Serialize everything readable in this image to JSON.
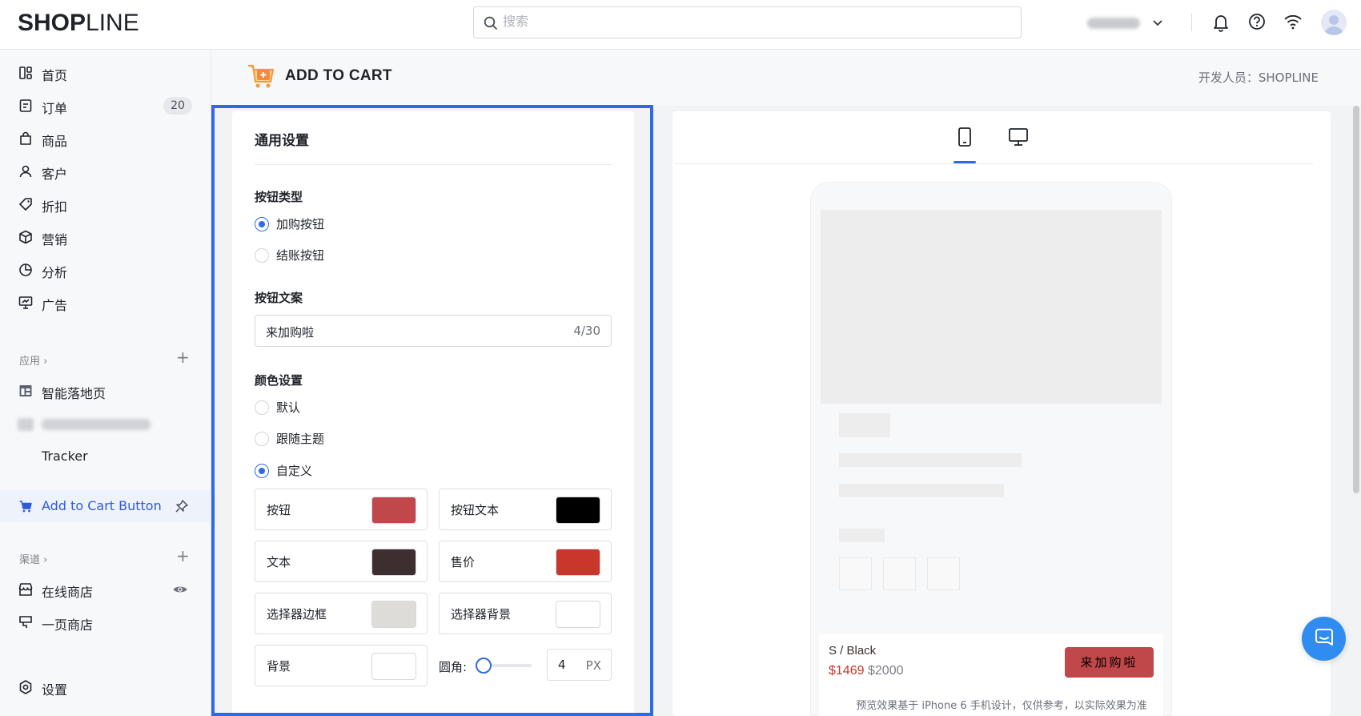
{
  "header": {
    "logo_bold": "SHOP",
    "logo_light": "LINE",
    "search_placeholder": "搜索",
    "icons": [
      "bell-icon",
      "help-icon",
      "wifi-icon",
      "avatar"
    ]
  },
  "sidebar": {
    "items": [
      {
        "label": "首页",
        "icon": "dashboard-icon"
      },
      {
        "label": "订单",
        "icon": "order-icon",
        "badge": "20"
      },
      {
        "label": "商品",
        "icon": "bag-icon"
      },
      {
        "label": "客户",
        "icon": "user-icon"
      },
      {
        "label": "折扣",
        "icon": "tag-icon"
      },
      {
        "label": "营销",
        "icon": "box-icon"
      },
      {
        "label": "分析",
        "icon": "pie-icon"
      },
      {
        "label": "广告",
        "icon": "ad-icon"
      }
    ],
    "apps_label": "应用",
    "apps": [
      {
        "label": "智能落地页",
        "icon": "layout-icon"
      },
      {
        "label": "Tracker",
        "icon": ""
      }
    ],
    "selected_app": "Add to Cart Button",
    "channels_label": "渠道",
    "channels": [
      {
        "label": "在线商店",
        "icon": "store-icon"
      },
      {
        "label": "一页商店",
        "icon": "page-store-icon"
      }
    ],
    "settings_label": "设置"
  },
  "page": {
    "title": "ADD TO CART",
    "developer": "开发人员：SHOPLINE"
  },
  "settings": {
    "title": "通用设置",
    "button_type_label": "按钮类型",
    "button_types": [
      "加购按钮",
      "结账按钮"
    ],
    "button_type_selected": 0,
    "button_text_label": "按钮文案",
    "button_text_value": "来加购啦",
    "button_text_count": "4/30",
    "color_label": "颜色设置",
    "color_modes": [
      "默认",
      "跟随主题",
      "自定义"
    ],
    "color_mode_selected": 2,
    "colors": [
      {
        "label": "按钮",
        "color": "#c0474a"
      },
      {
        "label": "按钮文本",
        "color": "#000000"
      },
      {
        "label": "文本",
        "color": "#3d2f2f"
      },
      {
        "label": "售价",
        "color": "#c9372c"
      },
      {
        "label": "选择器边框",
        "color": "#dddcd8"
      },
      {
        "label": "选择器背景",
        "color": "#ffffff"
      },
      {
        "label": "背景",
        "color": "#ffffff"
      }
    ],
    "radius_label": "圆角:",
    "radius_value": "4",
    "radius_unit": "PX"
  },
  "preview": {
    "tabs": [
      "mobile-icon",
      "desktop-icon"
    ],
    "active_tab": 0,
    "variant": "S / Black",
    "sale_price": "$1469",
    "original_price": "$2000",
    "buy_button_text": "来加购啦",
    "note": "预览效果基于 iPhone 6 手机设计，仅供参考，以实际效果为准"
  }
}
